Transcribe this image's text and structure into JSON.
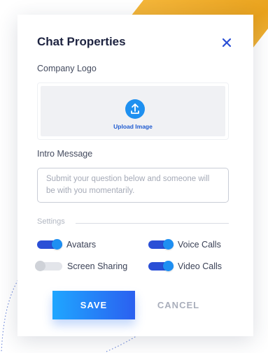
{
  "dialog": {
    "title": "Chat Properties",
    "close_icon": "close-icon"
  },
  "logo": {
    "label": "Company Logo",
    "upload_icon": "upload-icon",
    "upload_text": "Upload Image"
  },
  "intro": {
    "label": "Intro Message",
    "placeholder": "Submit your question below and someone will be with you momentarily."
  },
  "settings": {
    "label": "Settings",
    "toggles": [
      {
        "label": "Avatars",
        "on": true
      },
      {
        "label": "Screen Sharing",
        "on": false
      },
      {
        "label": "Voice Calls",
        "on": true
      },
      {
        "label": "Video Calls",
        "on": true
      }
    ]
  },
  "actions": {
    "save_label": "SAVE",
    "cancel_label": "CANCEL"
  },
  "colors": {
    "accent": "#2a4fd6",
    "accent_light": "#1e8ff2",
    "title": "#1d2340",
    "decor_gold": "#f0ad2e"
  }
}
